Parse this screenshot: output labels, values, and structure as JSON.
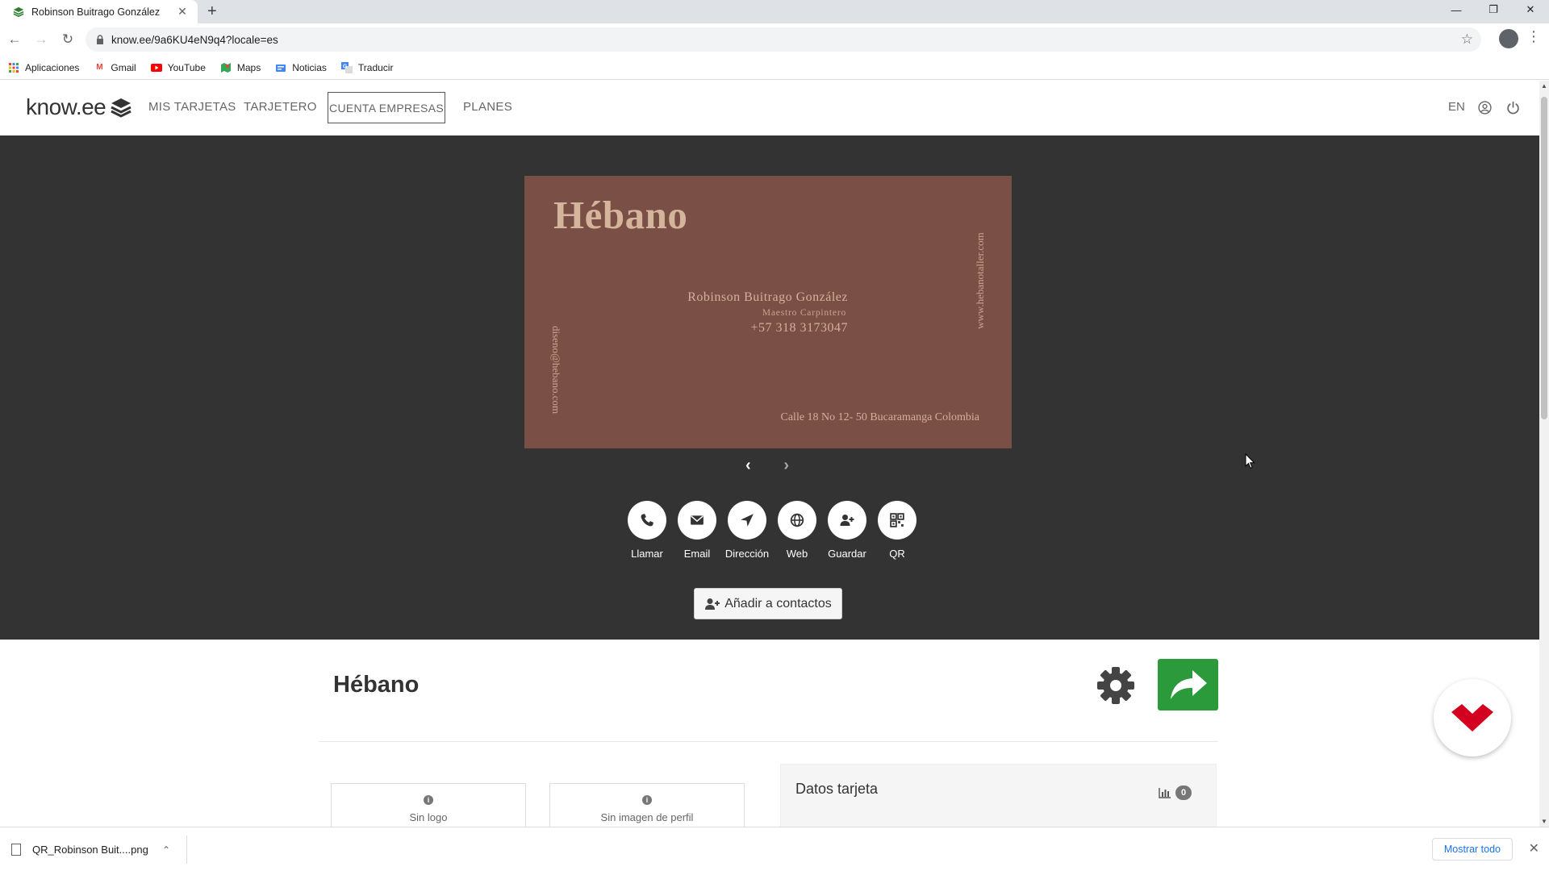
{
  "browser": {
    "tab_title": "Robinson Buitrago González",
    "tab_close": "✕",
    "new_tab": "+",
    "url": "know.ee/9a6KU4eN9q4?locale=es",
    "bookmarks": [
      {
        "label": "Aplicaciones",
        "icon": "apps-grid-icon"
      },
      {
        "label": "Gmail",
        "icon": "gmail-icon"
      },
      {
        "label": "YouTube",
        "icon": "youtube-icon"
      },
      {
        "label": "Maps",
        "icon": "maps-icon"
      },
      {
        "label": "Noticias",
        "icon": "news-icon"
      },
      {
        "label": "Traducir",
        "icon": "translate-icon"
      }
    ]
  },
  "site": {
    "logo": "know.ee",
    "nav": {
      "mis_tarjetas": "MIS TARJETAS",
      "tarjetero": "TARJETERO",
      "cuenta_empresas": "CUENTA EMPRESAS",
      "planes": "PLANES",
      "lang": "EN"
    }
  },
  "business_card": {
    "brand": "Hébano",
    "name": "Robinson Buitrago González",
    "role": "Maestro Carpintero",
    "phone": "+57 318 3173047",
    "address": "Calle 18 No 12- 50 Bucaramanga Colombia",
    "website": "www.hebanotaller.com",
    "email": "diseno@hebano.com",
    "background_color": "#7a4f45"
  },
  "actions": [
    {
      "label": "Llamar",
      "icon": "phone-icon"
    },
    {
      "label": "Email",
      "icon": "envelope-icon"
    },
    {
      "label": "Dirección",
      "icon": "location-arrow-icon"
    },
    {
      "label": "Web",
      "icon": "globe-icon"
    },
    {
      "label": "Guardar",
      "icon": "user-plus-icon"
    },
    {
      "label": "QR",
      "icon": "qrcode-icon"
    }
  ],
  "add_contacts_label": "Añadir a contactos",
  "detail": {
    "title": "Hébano",
    "no_logo": "Sin logo",
    "no_profile_image": "Sin imagen de perfil",
    "datos_title": "Datos tarjeta",
    "stats_count": "0"
  },
  "downloads": {
    "file_name": "QR_Robinson Buit....png",
    "show_all": "Mostrar todo"
  },
  "colors": {
    "hero_bg": "#333333",
    "share_green": "#2a9a3a",
    "link_blue": "#1a73e8"
  }
}
